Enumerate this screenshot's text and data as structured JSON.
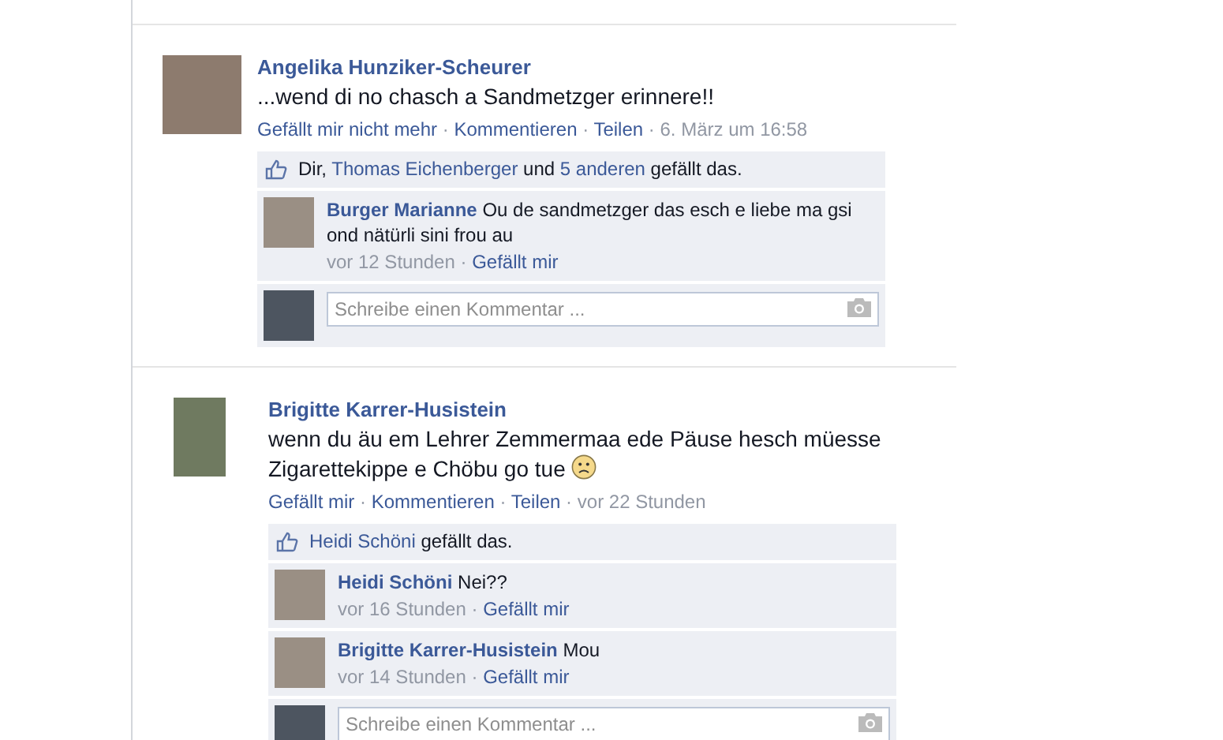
{
  "posts": [
    {
      "author": "Angelika Hunziker-Scheurer",
      "text": "...wend di no chasch a Sandmetzger erinnere!!",
      "emoticon": false,
      "actions": [
        {
          "text": "Gefällt mir nicht mehr",
          "kind": "link"
        },
        {
          "text": " · ",
          "kind": "plain"
        },
        {
          "text": "Kommentieren",
          "kind": "link"
        },
        {
          "text": " · ",
          "kind": "plain"
        },
        {
          "text": "Teilen",
          "kind": "link"
        },
        {
          "text": " · ",
          "kind": "plain"
        },
        {
          "text": "6. März um 16:58",
          "kind": "plain"
        }
      ],
      "likes": [
        {
          "text": "Dir, ",
          "kind": "plain"
        },
        {
          "text": "Thomas Eichenberger",
          "kind": "link"
        },
        {
          "text": " und ",
          "kind": "plain"
        },
        {
          "text": "5 anderen",
          "kind": "link"
        },
        {
          "text": " gefällt das.",
          "kind": "plain"
        }
      ],
      "comments": [
        {
          "author": "Burger Marianne",
          "text": "Ou de sandmetzger das esch e liebe ma gsi ond nätürli sini frou au",
          "time": "vor 12 Stunden",
          "sep": " · ",
          "like": "Gefällt mir"
        }
      ],
      "comment_field": {
        "placeholder": "Schreibe einen Kommentar ..."
      }
    },
    {
      "author": "Brigitte Karrer-Husistein",
      "text": "wenn du äu em Lehrer Zemmermaa ede Päuse hesch müesse Zigarettekippe e Chöbu go tue",
      "emoticon": true,
      "actions": [
        {
          "text": "Gefällt mir",
          "kind": "link"
        },
        {
          "text": " · ",
          "kind": "plain"
        },
        {
          "text": "Kommentieren",
          "kind": "link"
        },
        {
          "text": " · ",
          "kind": "plain"
        },
        {
          "text": "Teilen",
          "kind": "link"
        },
        {
          "text": " · ",
          "kind": "plain"
        },
        {
          "text": "vor 22 Stunden",
          "kind": "plain"
        }
      ],
      "likes": [
        {
          "text": "Heidi Schöni",
          "kind": "link"
        },
        {
          "text": " gefällt das.",
          "kind": "plain"
        }
      ],
      "comments": [
        {
          "author": "Heidi Schöni",
          "text": "Nei??",
          "time": "vor 16 Stunden",
          "sep": " · ",
          "like": "Gefällt mir"
        },
        {
          "author": "Brigitte Karrer-Husistein",
          "text": "Mou",
          "time": "vor 14 Stunden",
          "sep": " · ",
          "like": "Gefällt mir"
        }
      ],
      "comment_field": {
        "placeholder": "Schreibe einen Kommentar ..."
      }
    }
  ]
}
